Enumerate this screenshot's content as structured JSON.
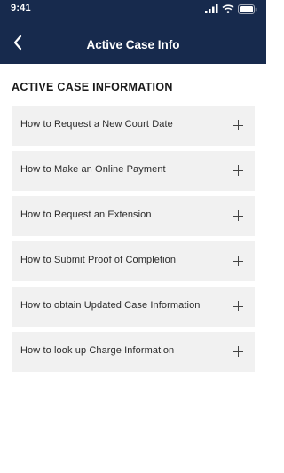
{
  "status_bar": {
    "time": "9:41"
  },
  "header": {
    "title": "Active Case Info",
    "back_icon": "chevron-left-icon"
  },
  "section": {
    "title": "ACTIVE CASE INFORMATION"
  },
  "items": [
    {
      "label": "How to Request a New Court Date",
      "icon": "plus-icon"
    },
    {
      "label": "How to Make an Online Payment",
      "icon": "plus-icon"
    },
    {
      "label": "How to Request an Extension",
      "icon": "plus-icon"
    },
    {
      "label": "How to Submit Proof of Completion",
      "icon": "plus-icon"
    },
    {
      "label": "How to obtain Updated Case Information",
      "icon": "plus-icon"
    },
    {
      "label": "How to look up Charge Information",
      "icon": "plus-icon"
    }
  ],
  "colors": {
    "header_bg": "#172a4d",
    "item_bg": "#f1f1f1",
    "text": "#2b2b2b"
  }
}
